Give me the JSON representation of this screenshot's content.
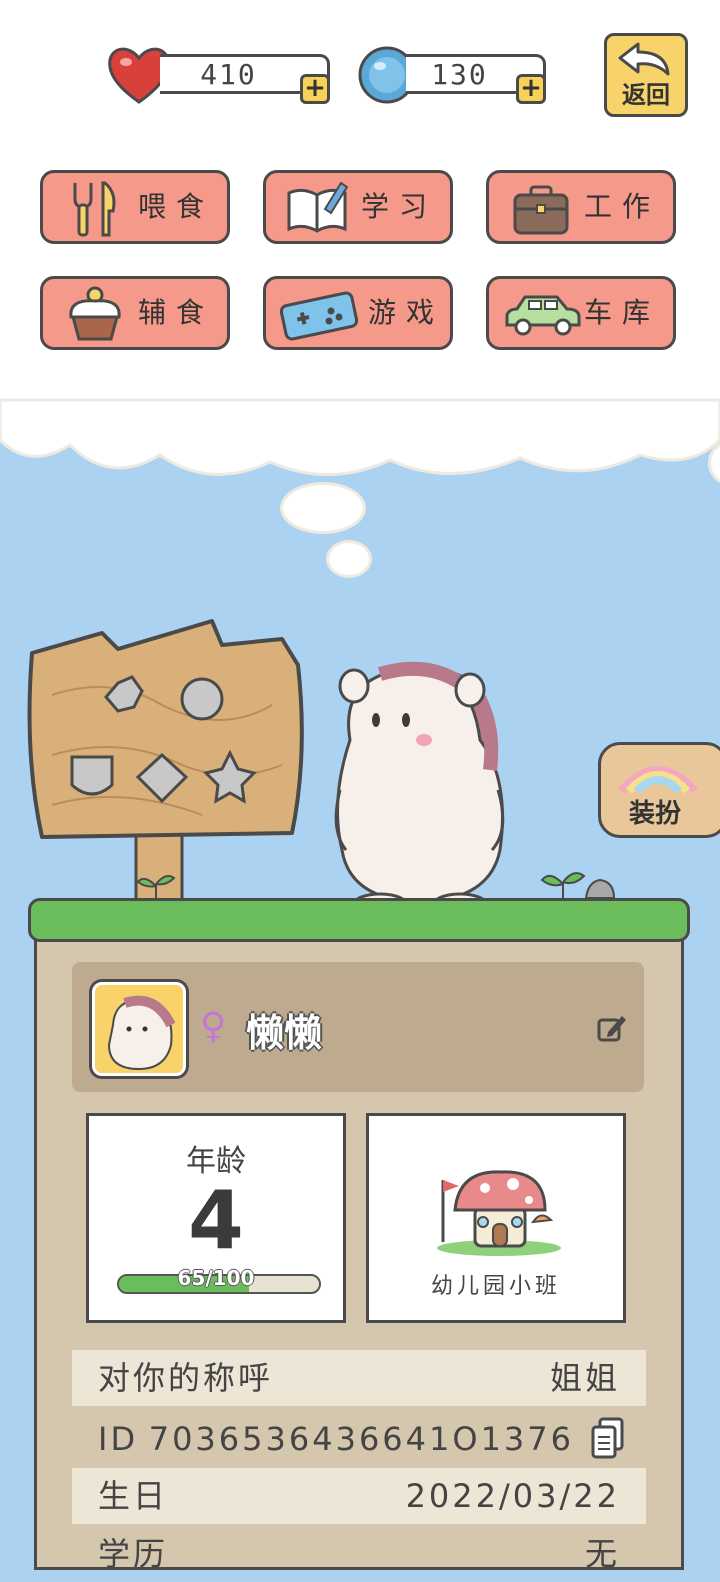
{
  "currency": {
    "hearts": "410",
    "coins": "130",
    "plus_label": "+"
  },
  "header": {
    "back_label": "返回"
  },
  "menu": [
    {
      "label": "喂食",
      "icon": "fork-knife-icon"
    },
    {
      "label": "学习",
      "icon": "book-pen-icon"
    },
    {
      "label": "工作",
      "icon": "briefcase-icon"
    },
    {
      "label": "辅食",
      "icon": "cupcake-icon"
    },
    {
      "label": "游戏",
      "icon": "gamepad-icon"
    },
    {
      "label": "车库",
      "icon": "car-icon"
    }
  ],
  "dress_button": {
    "label": "装扮",
    "icon": "rainbow-icon"
  },
  "profile": {
    "gender_symbol": "♀",
    "name": "懒懒"
  },
  "age_card": {
    "title": "年龄",
    "age": "4",
    "xp_text": "65/100",
    "xp_fraction": 0.65
  },
  "school_card": {
    "label": "幼儿园小班",
    "icon": "mushroom-house-icon"
  },
  "info_rows": [
    {
      "key": "对你的称呼",
      "value": "姐姐"
    },
    {
      "key": "ID",
      "value": "7036536436641O1376"
    },
    {
      "key": "生日",
      "value": "2022/03/22"
    },
    {
      "key": "学历",
      "value": "无"
    }
  ],
  "colors": {
    "sky": "#acd2f2",
    "menu_button": "#f5998a",
    "accent_yellow": "#f8d36a",
    "grass": "#6bbc5a",
    "panel": "#d5c7ae"
  }
}
